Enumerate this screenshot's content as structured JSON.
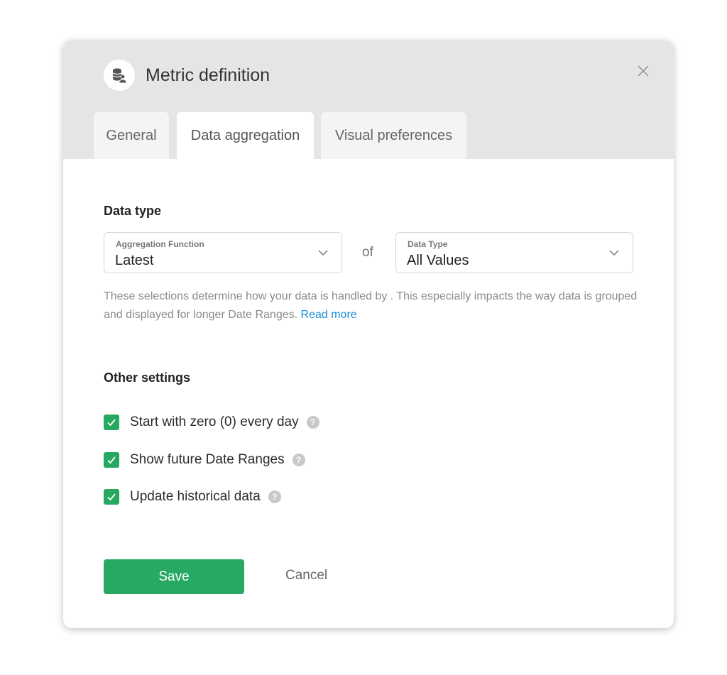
{
  "dialog": {
    "title": "Metric definition",
    "icon": "database-user-icon"
  },
  "tabs": [
    {
      "label": "General",
      "active": false
    },
    {
      "label": "Data aggregation",
      "active": true
    },
    {
      "label": "Visual preferences",
      "active": false
    }
  ],
  "data_type": {
    "section_title": "Data type",
    "aggregation": {
      "label": "Aggregation Function",
      "value": "Latest"
    },
    "of_text": "of",
    "data_type_select": {
      "label": "Data Type",
      "value": "All Values"
    },
    "helper_text": "These selections determine how your data is handled by . This especially impacts the way data is grouped and displayed for longer Date Ranges.",
    "helper_link": "Read more"
  },
  "other_settings": {
    "section_title": "Other settings",
    "options": [
      {
        "label": "Start with zero (0) every day",
        "checked": true
      },
      {
        "label": "Show future Date Ranges",
        "checked": true
      },
      {
        "label": "Update historical data",
        "checked": true
      }
    ]
  },
  "actions": {
    "save_label": "Save",
    "cancel_label": "Cancel"
  },
  "colors": {
    "accent_green": "#27a863",
    "link_blue": "#1a8ed6",
    "header_gray": "#e5e5e5"
  }
}
